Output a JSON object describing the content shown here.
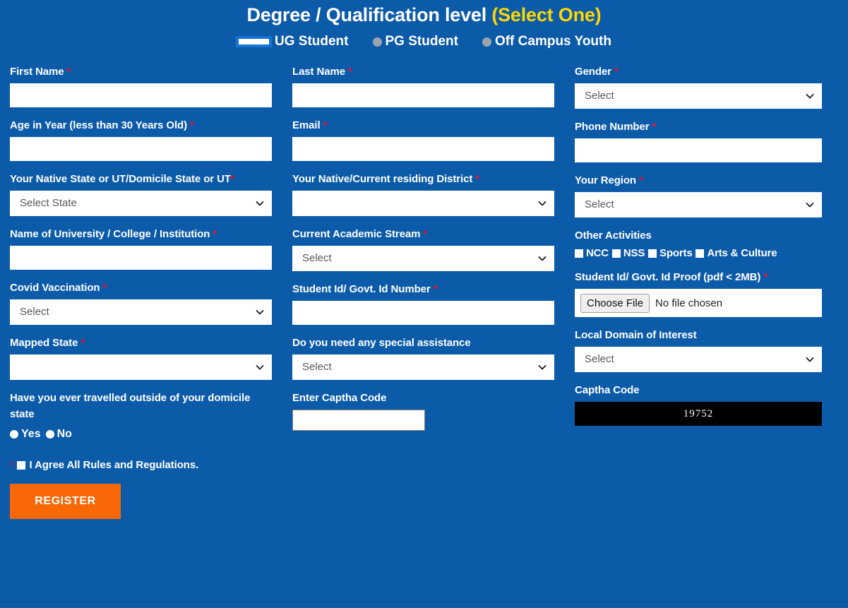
{
  "header": {
    "title_main": "Degree / Qualification level ",
    "title_accent": "(Select One)",
    "options": [
      {
        "label": "UG Student",
        "selected": true
      },
      {
        "label": "PG Student",
        "selected": false
      },
      {
        "label": "Off Campus Youth",
        "selected": false
      }
    ]
  },
  "fields": {
    "first_name": {
      "label": "First Name",
      "required": "*",
      "value": ""
    },
    "last_name": {
      "label": "Last Name",
      "required": "*",
      "value": ""
    },
    "gender": {
      "label": "Gender",
      "required": "*",
      "value": "Select"
    },
    "age": {
      "label": "Age in Year (less than 30 Years Old)",
      "required": "*",
      "value": ""
    },
    "email": {
      "label": "Email",
      "required": "*",
      "value": ""
    },
    "phone": {
      "label": "Phone Number",
      "required": "*",
      "value": ""
    },
    "native_state": {
      "label": "Your Native State or UT/Domicile State or UT",
      "required": "*",
      "value": "Select State"
    },
    "district": {
      "label": "Your Native/Current residing District",
      "required": "*",
      "value": ""
    },
    "region": {
      "label": "Your Region",
      "required": "*",
      "value": "Select"
    },
    "institution": {
      "label": "Name of University / College / Institution",
      "required": "*",
      "value": ""
    },
    "stream": {
      "label": "Current Academic Stream",
      "required": "*",
      "value": "Select"
    },
    "other_activities": {
      "label": "Other Activities",
      "items": [
        {
          "label": "NCC",
          "checked": false
        },
        {
          "label": "NSS",
          "checked": false
        },
        {
          "label": "Sports",
          "checked": false
        },
        {
          "label": "Arts & Culture",
          "checked": false
        }
      ]
    },
    "covid": {
      "label": "Covid Vaccination",
      "required": "*",
      "value": "Select"
    },
    "student_id_number": {
      "label": "Student Id/ Govt. Id Number",
      "required": "*",
      "value": ""
    },
    "id_proof": {
      "label": "Student Id/ Govt. Id Proof (pdf < 2MB)",
      "required": "*",
      "button_label": "Choose File",
      "status": "No file chosen"
    },
    "mapped_state": {
      "label": "Mapped State",
      "required": "*",
      "value": ""
    },
    "special_assistance": {
      "label": "Do you need any special assistance",
      "required": "",
      "value": "Select"
    },
    "local_domain": {
      "label": "Local Domain of Interest",
      "required": "",
      "value": "Select"
    },
    "travelled": {
      "label": "Have you ever travelled outside of your domicile state",
      "options": [
        {
          "label": "Yes",
          "selected": false
        },
        {
          "label": "No",
          "selected": false
        }
      ]
    },
    "enter_captcha": {
      "label": "Enter Captha Code",
      "value": ""
    },
    "captcha": {
      "label": "Captha Code",
      "code": "19752"
    }
  },
  "agree": {
    "required": "*",
    "label": "I Agree All Rules and Regulations.",
    "checked": false
  },
  "submit": {
    "label": "REGISTER"
  },
  "colors": {
    "background": "#0b5ba9",
    "accent_yellow": "#ffd700",
    "required_red": "#e8112d",
    "submit_orange": "#f96806",
    "captcha_bg": "#000000"
  }
}
